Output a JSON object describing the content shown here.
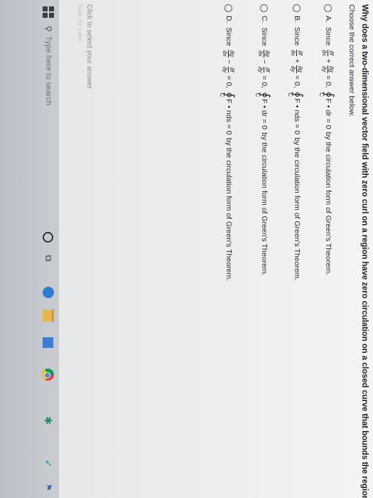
{
  "question": {
    "text": "Why does a two-dimensional vector field with zero curl on a region have zero circulation on a closed curve that bounds the region?",
    "instruction": "Choose the correct answer below."
  },
  "options": [
    {
      "letter": "A.",
      "since": "Since",
      "term1": {
        "num": "∂f",
        "den": "∂x"
      },
      "op": "+",
      "term2": {
        "num": "∂g",
        "den": "∂y"
      },
      "eq": "= 0,",
      "integral_sub": "C",
      "integrand": "F • dr = 0",
      "explanation": "by the circulation form of Green's Theorem."
    },
    {
      "letter": "B.",
      "since": "Since",
      "term1": {
        "num": "∂f",
        "den": "∂x"
      },
      "op": "+",
      "term2": {
        "num": "∂g",
        "den": "∂y"
      },
      "eq": "= 0,",
      "integral_sub": "C",
      "integrand": "F • nds = 0",
      "explanation": "by the circulation form of Green's Theorem."
    },
    {
      "letter": "C.",
      "since": "Since",
      "term1": {
        "num": "∂g",
        "den": "∂x"
      },
      "op": "−",
      "term2": {
        "num": "∂f",
        "den": "∂y"
      },
      "eq": "= 0,",
      "integral_sub": "C",
      "integrand": "F • dr = 0",
      "explanation": "by the circulation form of Green's Theorem."
    },
    {
      "letter": "D.",
      "since": "Since",
      "term1": {
        "num": "∂g",
        "den": "∂x"
      },
      "op": "−",
      "term2": {
        "num": "∂f",
        "den": "∂y"
      },
      "eq": "= 0,",
      "integral_sub": "C",
      "integrand": "F • nds = 0",
      "explanation": "by the circulation form of Green's Theorem."
    }
  ],
  "footer": {
    "select_hint": "Click to select your answer",
    "save_hint": "Save for Later"
  },
  "taskbar": {
    "search_placeholder": "Type here to search",
    "search_icon": "magnifier-icon",
    "task_view_glyph": "⧉",
    "tray_app_glyph": "✱",
    "tray_cursor_glyph": "➶",
    "tray_flag_glyph": "⚑"
  }
}
